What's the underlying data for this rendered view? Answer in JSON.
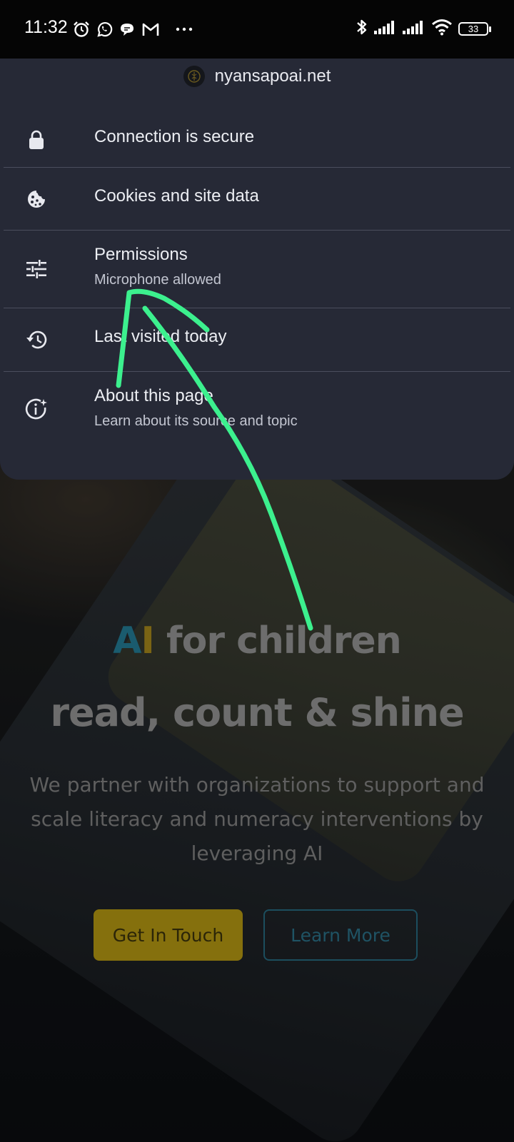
{
  "status_bar": {
    "time": "11:32",
    "left_icons": [
      "alarm-icon",
      "whatsapp-icon",
      "chat-bubble-icon",
      "gmail-icon",
      "more-dots-icon"
    ],
    "right_icons": [
      "bluetooth-icon",
      "signal-icon",
      "signal-icon",
      "wifi-icon"
    ],
    "battery_level": "33"
  },
  "site_info": {
    "domain": "nyansapoai.net",
    "items": [
      {
        "icon": "lock-icon",
        "title": "Connection is secure"
      },
      {
        "icon": "cookie-icon",
        "title": "Cookies and site data"
      },
      {
        "icon": "tune-sliders-icon",
        "title": "Permissions",
        "subtitle": "Microphone allowed"
      },
      {
        "icon": "history-icon",
        "title": "Last visited today"
      },
      {
        "icon": "info-sparkle-icon",
        "title": "About this page",
        "subtitle": "Learn about its source and topic"
      }
    ]
  },
  "page": {
    "hero_ai_a": "A",
    "hero_ai_i": "I",
    "hero_line1_rest": " for children",
    "hero_line2": "read, count & shine",
    "hero_sub": "We partner with organizations to support and scale literacy and numeracy interventions by leveraging AI",
    "cta_primary": "Get In Touch",
    "cta_secondary": "Learn More"
  },
  "colors": {
    "sheet_bg": "#262936",
    "annotation_stroke": "#3cf08e",
    "cta_primary_bg": "#85700d",
    "cta_secondary_border": "#1c4e5e"
  }
}
